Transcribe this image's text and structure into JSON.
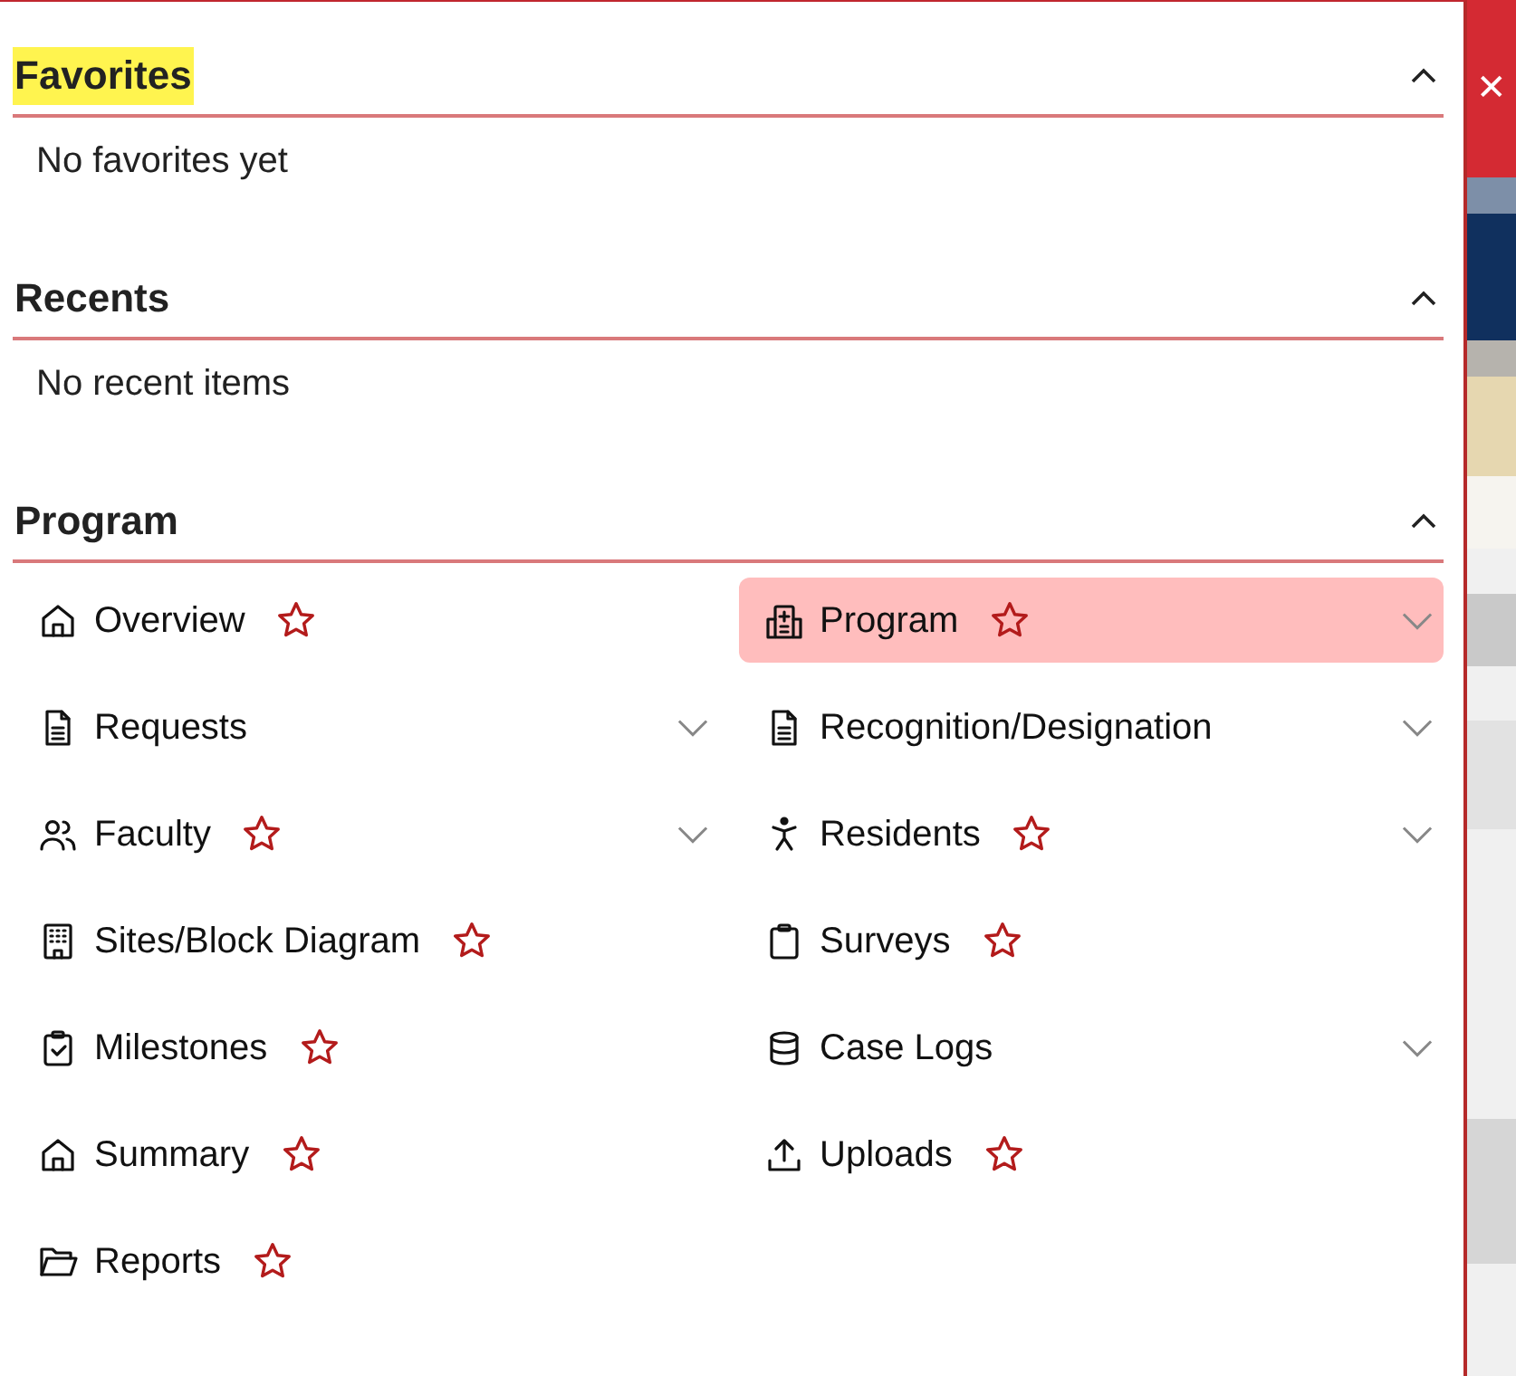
{
  "close_button": {
    "label": "✕"
  },
  "sections": [
    {
      "title": "Favorites",
      "highlighted": true,
      "expanded": true,
      "empty_text": "No favorites yet"
    },
    {
      "title": "Recents",
      "highlighted": false,
      "expanded": true,
      "empty_text": "No recent items"
    },
    {
      "title": "Program",
      "highlighted": false,
      "expanded": true,
      "columns": [
        [
          {
            "label": "Overview",
            "has_star": true,
            "expandable": false,
            "selected": false
          },
          {
            "label": "Requests",
            "has_star": false,
            "expandable": true,
            "selected": false
          },
          {
            "label": "Faculty",
            "has_star": true,
            "expandable": true,
            "selected": false
          },
          {
            "label": "Sites/Block Diagram",
            "has_star": true,
            "expandable": false,
            "selected": false
          },
          {
            "label": "Milestones",
            "has_star": true,
            "expandable": false,
            "selected": false
          },
          {
            "label": "Summary",
            "has_star": true,
            "expandable": false,
            "selected": false
          },
          {
            "label": "Reports",
            "has_star": true,
            "expandable": false,
            "selected": false
          }
        ],
        [
          {
            "label": "Program",
            "has_star": true,
            "expandable": true,
            "selected": true
          },
          {
            "label": "Recognition/Designation",
            "has_star": false,
            "expandable": true,
            "selected": false
          },
          {
            "label": "Residents",
            "has_star": true,
            "expandable": true,
            "selected": false
          },
          {
            "label": "Surveys",
            "has_star": true,
            "expandable": false,
            "selected": false
          },
          {
            "label": "Case Logs",
            "has_star": false,
            "expandable": true,
            "selected": false
          },
          {
            "label": "Uploads",
            "has_star": true,
            "expandable": false,
            "selected": false
          }
        ]
      ]
    }
  ]
}
